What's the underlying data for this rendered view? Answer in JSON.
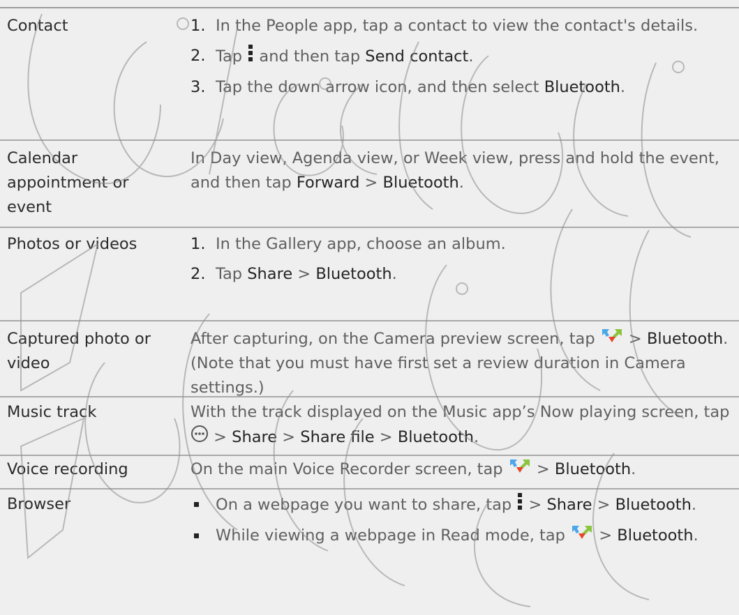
{
  "rows": [
    {
      "label": "Contact",
      "steps": [
        {
          "num": "1.",
          "text": "In the People app, tap a contact to view the contact's details."
        },
        {
          "num": "2.",
          "pre": "Tap",
          "mid": "and then tap",
          "em": "Send contact",
          "post": "."
        },
        {
          "num": "3.",
          "pre": "Tap the down arrow icon, and then select",
          "em": "Bluetooth",
          "post": "."
        }
      ]
    },
    {
      "label": "Calendar appointment or event",
      "text_pre": "In Day view, Agenda view, or Week view, press and hold the event, and then tap",
      "em1": "Forward",
      "sep": ">",
      "em2": "Bluetooth",
      "post": "."
    },
    {
      "label": "Photos or videos",
      "steps": [
        {
          "num": "1.",
          "text": "In the Gallery app, choose an album."
        },
        {
          "num": "2.",
          "pre": "Tap",
          "em1": "Share",
          "sep": ">",
          "em2": "Bluetooth",
          "post": "."
        }
      ]
    },
    {
      "label": "Captured photo or video",
      "pre": "After capturing, on the Camera preview screen, tap",
      "sep": ">",
      "em": "Bluetooth",
      "post": ". (Note that you must have first set a review duration in Camera settings.)"
    },
    {
      "label": "Music track",
      "pre": "With the track displayed on the Music app’s Now playing screen, tap",
      "sep1": ">",
      "em1": "Share",
      "sep2": ">",
      "em2": "Share file",
      "sep3": ">",
      "em3": "Bluetooth",
      "post": "."
    },
    {
      "label": "Voice recording",
      "pre": "On the main Voice Recorder screen, tap",
      "sep": ">",
      "em": "Bluetooth",
      "post": "."
    },
    {
      "label": "Browser",
      "bullets": [
        {
          "pre": "On a webpage you want to share, tap",
          "sep1": ">",
          "em1": "Share",
          "sep2": ">",
          "em2": "Bluetooth",
          "post": "."
        },
        {
          "pre": "While viewing a webpage in Read mode, tap",
          "sep": ">",
          "em": "Bluetooth",
          "post": "."
        }
      ]
    }
  ],
  "icons": {
    "menu": "menu-dots-icon",
    "share": "share-icon",
    "more": "more-options-icon"
  },
  "colors": {
    "background": "#efefef",
    "body_text": "#5f5f5f",
    "emphasis_text": "#232323",
    "divider": "#a9a9a9"
  }
}
